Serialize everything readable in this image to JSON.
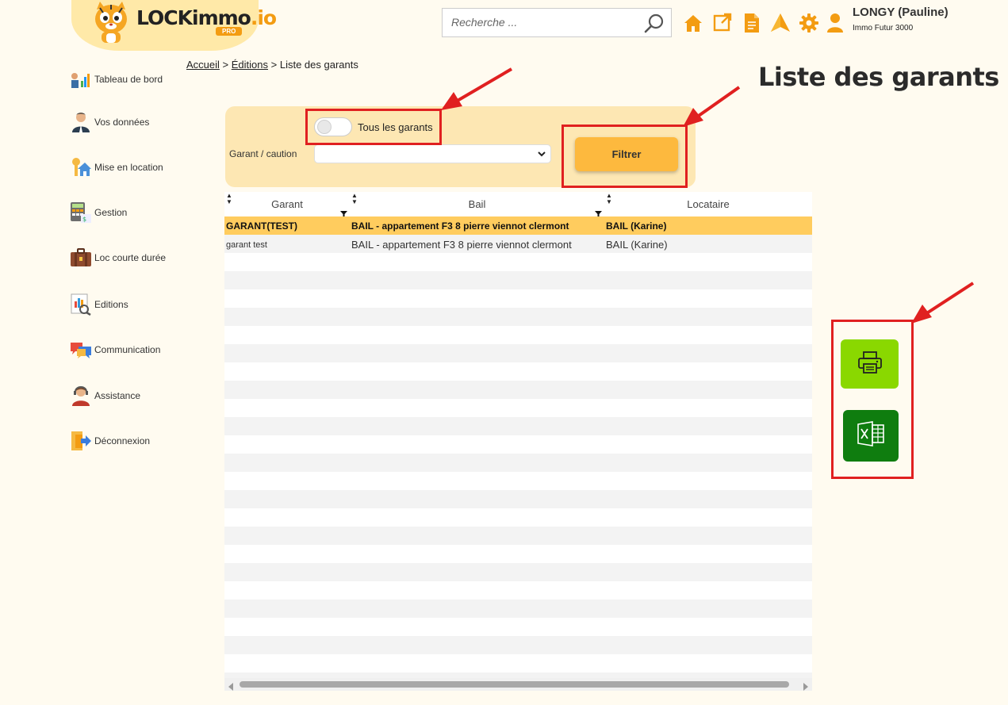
{
  "header": {
    "logo_text": "LOCKimmo",
    "logo_suffix": ".io",
    "logo_badge": "PRO",
    "search_placeholder": "Recherche ...",
    "user_name": "LONGY (Pauline)",
    "user_company": "Immo Futur 3000",
    "icons": [
      "home-icon",
      "external-link-icon",
      "document-icon",
      "notification-icon",
      "gear-icon",
      "user-icon"
    ],
    "accent_color": "#f39c12"
  },
  "sidebar": {
    "items": [
      {
        "label": "Tableau de bord",
        "icon": "dashboard-icon"
      },
      {
        "label": "Vos données",
        "icon": "profile-icon"
      },
      {
        "label": "Mise en location",
        "icon": "house-key-icon"
      },
      {
        "label": "Gestion",
        "icon": "calculator-icon"
      },
      {
        "label": "Loc courte durée",
        "icon": "suitcase-icon"
      },
      {
        "label": "Editions",
        "icon": "report-icon"
      },
      {
        "label": "Communication",
        "icon": "chat-icon"
      },
      {
        "label": "Assistance",
        "icon": "support-icon"
      },
      {
        "label": "Déconnexion",
        "icon": "logout-icon"
      }
    ]
  },
  "breadcrumb": {
    "home": "Accueil",
    "sep1": ">",
    "section": "Éditions",
    "sep2": ">",
    "current": "Liste des garants"
  },
  "page_title": "Liste des garants",
  "filter": {
    "toggle_label": "Tous les garants",
    "toggle_on": false,
    "guarantor_label": "Garant / caution",
    "guarantor_value": "",
    "button_label": "Filtrer"
  },
  "table": {
    "columns": [
      "Garant",
      "Bail",
      "Locataire"
    ],
    "rows": [
      {
        "garant": "GARANT(TEST)",
        "bail": "BAIL - appartement F3 8 pierre viennot clermont",
        "locataire": "BAIL (Karine)",
        "selected": true
      },
      {
        "garant": "garant test",
        "bail": "BAIL - appartement F3 8 pierre viennot clermont",
        "locataire": "BAIL (Karine)",
        "selected": false
      }
    ]
  },
  "export": {
    "print_icon": "printer-icon",
    "excel_icon": "excel-icon",
    "print_color": "#8ad800",
    "excel_color": "#0f7d0f"
  },
  "annotation_color": "#e02020"
}
